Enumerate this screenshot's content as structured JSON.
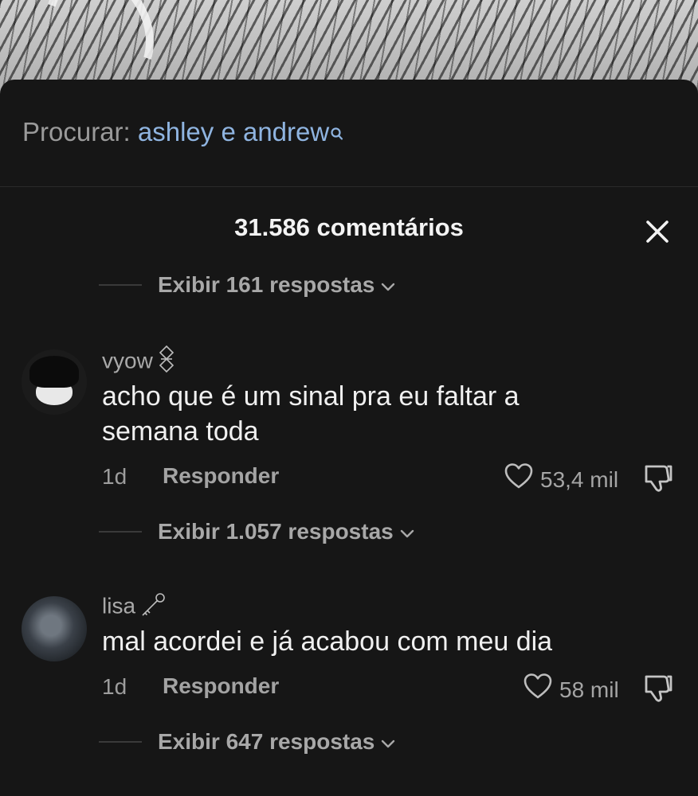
{
  "search": {
    "label": "Procurar:",
    "query": "ashley e andrew",
    "icon": "search-icon"
  },
  "header": {
    "count_title": "31.586 comentários",
    "close_icon": "close-icon"
  },
  "top_replies": {
    "label": "Exibir 161 respostas"
  },
  "comments": [
    {
      "username": "vyow",
      "badge_icon": "ribbon-icon",
      "text_line1": "acho que é um sinal pra eu faltar a",
      "text_line2": "semana toda",
      "age": "1d",
      "reply_label": "Responder",
      "likes": "53,4 mil",
      "view_replies": "Exibir 1.057 respostas"
    },
    {
      "username": "lisa",
      "badge_icon": "key-icon",
      "text_line1": "mal acordei e já acabou com meu dia",
      "age": "1d",
      "reply_label": "Responder",
      "likes": "58 mil",
      "view_replies": "Exibir 647 respostas"
    }
  ],
  "colors": {
    "background": "#161616",
    "query": "#8fb4e0",
    "muted": "#a5a5a5",
    "text": "#f0f0f0"
  }
}
